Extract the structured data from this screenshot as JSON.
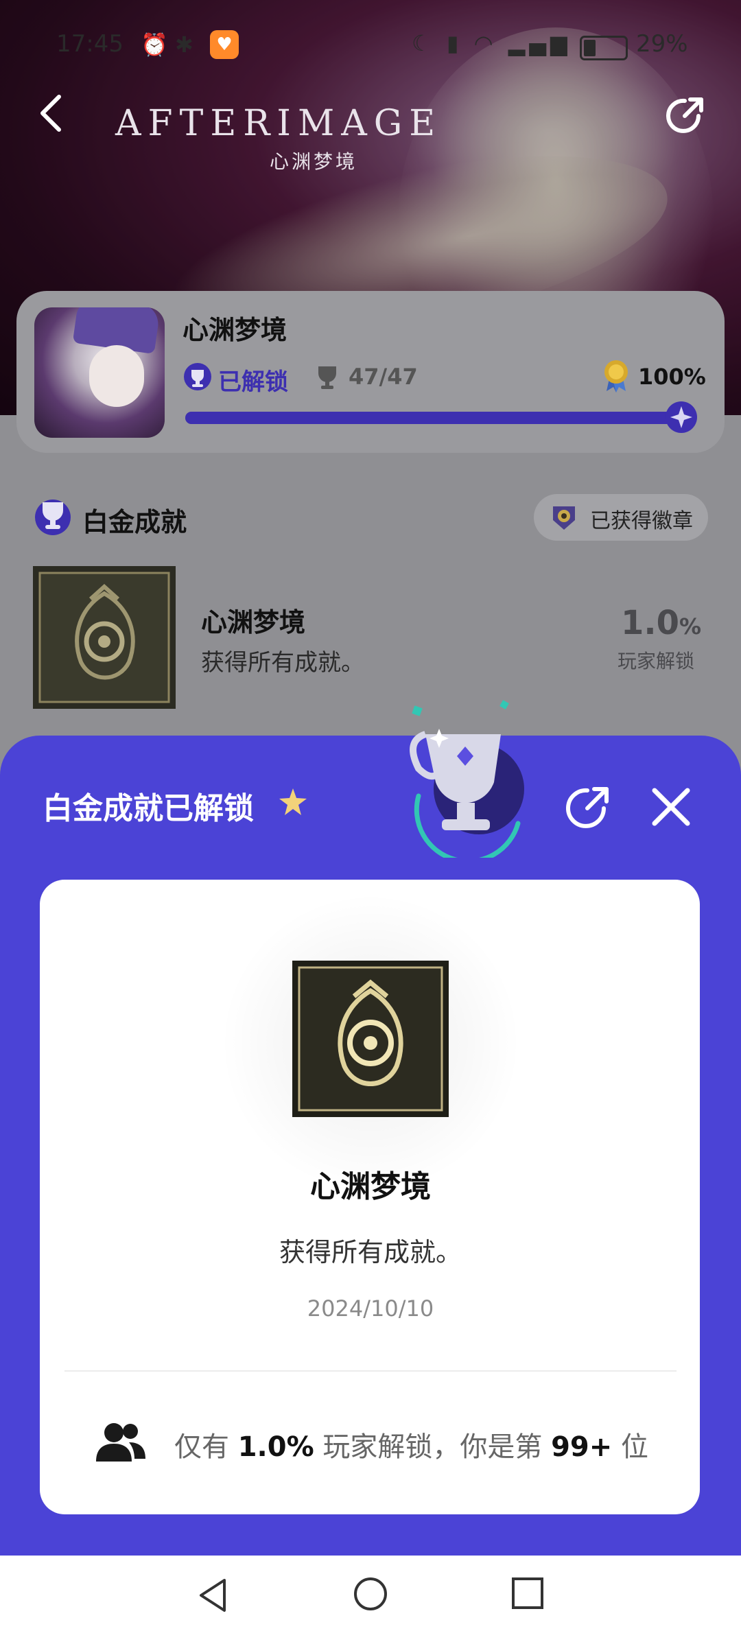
{
  "status_bar": {
    "time": "17:45",
    "battery_pct": "29%",
    "battery_level": 0.29
  },
  "header": {
    "logo": "AFTERIMAGE",
    "logo_sub": "心渊梦境"
  },
  "game": {
    "title": "心渊梦境",
    "unlock_label": "已解锁",
    "trophy_count": "47/47",
    "completion": "100%",
    "progress": 1.0
  },
  "platinum_section": {
    "title": "白金成就",
    "badge_label": "已获得徽章",
    "achievement": {
      "title": "心渊梦境",
      "description": "获得所有成就。",
      "rate": "1.0",
      "rate_unit": "%",
      "rate_label": "玩家解锁"
    }
  },
  "sheet": {
    "title": "白金成就已解锁",
    "card": {
      "title": "心渊梦境",
      "description": "获得所有成就。",
      "date": "2024/10/10",
      "stat_prefix": "仅有",
      "stat_rate": "1.0%",
      "stat_middle": "玩家解锁，你是第",
      "stat_rank": "99+",
      "stat_suffix": "位"
    }
  },
  "colors": {
    "accent": "#4b43d6",
    "accent_dark": "#3d2fb0",
    "gold": "#d8c27a"
  },
  "icons": [
    "back-arrow-icon",
    "share-icon",
    "unlock-trophy-icon",
    "trophy-cup-icon",
    "medal-icon",
    "platinum-icon",
    "badge-icon",
    "star-icon",
    "close-icon",
    "people-icon",
    "nav-back-icon",
    "nav-home-icon",
    "nav-recent-icon"
  ]
}
